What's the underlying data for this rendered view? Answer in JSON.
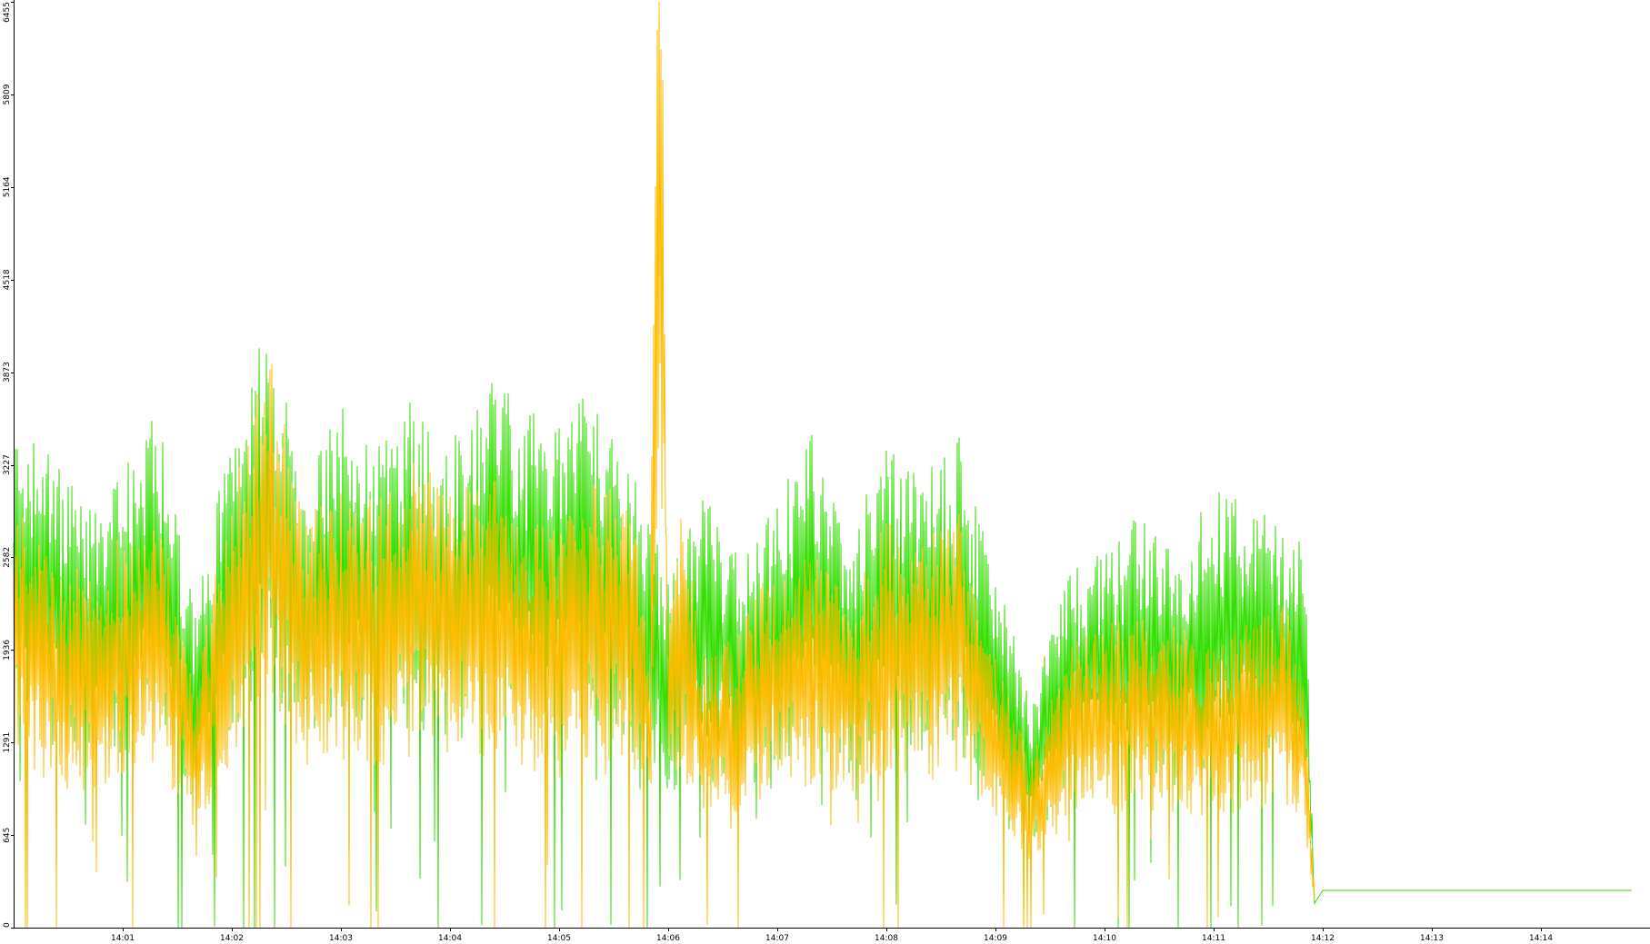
{
  "chart_data": {
    "type": "line",
    "title": "",
    "xlabel": "",
    "ylabel": "",
    "ylim": [
      0,
      6455
    ],
    "grid": false,
    "legend": "none",
    "y_ticks": [
      {
        "value": 0,
        "label": "0"
      },
      {
        "value": 645,
        "label": "645"
      },
      {
        "value": 1291,
        "label": "1291"
      },
      {
        "value": 1936,
        "label": "1936"
      },
      {
        "value": 2582,
        "label": "2582"
      },
      {
        "value": 3227,
        "label": "3227"
      },
      {
        "value": 3873,
        "label": "3873"
      },
      {
        "value": 4518,
        "label": "4518"
      },
      {
        "value": 5164,
        "label": "5164"
      },
      {
        "value": 5809,
        "label": "5809"
      },
      {
        "value": 6455,
        "label": "6455"
      }
    ],
    "xlim": [
      "14:00:00",
      "14:14:50"
    ],
    "x_ticks": [
      {
        "value": "14:01:00",
        "label": "14:01"
      },
      {
        "value": "14:02:00",
        "label": "14:02"
      },
      {
        "value": "14:03:00",
        "label": "14:03"
      },
      {
        "value": "14:04:00",
        "label": "14:04"
      },
      {
        "value": "14:05:00",
        "label": "14:05"
      },
      {
        "value": "14:06:00",
        "label": "14:06"
      },
      {
        "value": "14:07:00",
        "label": "14:07"
      },
      {
        "value": "14:08:00",
        "label": "14:08"
      },
      {
        "value": "14:09:00",
        "label": "14:09"
      },
      {
        "value": "14:10:00",
        "label": "14:10"
      },
      {
        "value": "14:11:00",
        "label": "14:11"
      },
      {
        "value": "14:12:00",
        "label": "14:12"
      },
      {
        "value": "14:13:00",
        "label": "14:13"
      },
      {
        "value": "14:14:00",
        "label": "14:14"
      }
    ],
    "series": [
      {
        "color": "#33dd00",
        "x": [
          "14:00:00",
          "14:00:20",
          "14:00:40",
          "14:01:00",
          "14:01:20",
          "14:01:40",
          "14:02:00",
          "14:02:20",
          "14:02:40",
          "14:03:00",
          "14:03:20",
          "14:03:40",
          "14:04:00",
          "14:04:20",
          "14:04:40",
          "14:05:00",
          "14:05:20",
          "14:05:40",
          "14:06:00",
          "14:06:20",
          "14:06:40",
          "14:07:00",
          "14:07:20",
          "14:07:40",
          "14:08:00",
          "14:08:20",
          "14:08:40",
          "14:09:00",
          "14:09:20",
          "14:09:40",
          "14:10:00",
          "14:10:20",
          "14:10:40",
          "14:11:00",
          "14:11:20",
          "14:11:40",
          "14:11:50",
          "14:11:55",
          "14:12:00",
          "14:13:00",
          "14:14:00",
          "14:14:50"
        ],
        "values": [
          2400,
          2300,
          2000,
          2200,
          2500,
          1500,
          2450,
          2900,
          2200,
          2500,
          2300,
          2550,
          2300,
          2700,
          2500,
          2450,
          2600,
          2200,
          1700,
          2100,
          1750,
          2050,
          2400,
          1900,
          2300,
          2200,
          2350,
          1700,
          1100,
          1750,
          1800,
          2000,
          1800,
          2100,
          2050,
          1900,
          1850,
          250,
          260,
          260,
          260,
          260
        ]
      },
      {
        "color": "#ffbb00",
        "x": [
          "14:00:00",
          "14:00:20",
          "14:00:40",
          "14:01:00",
          "14:01:20",
          "14:01:40",
          "14:02:00",
          "14:02:20",
          "14:02:40",
          "14:03:00",
          "14:03:20",
          "14:03:40",
          "14:04:00",
          "14:04:20",
          "14:04:40",
          "14:05:00",
          "14:05:20",
          "14:05:40",
          "14:05:50",
          "14:05:55",
          "14:06:00",
          "14:06:05",
          "14:06:20",
          "14:06:40",
          "14:07:00",
          "14:07:20",
          "14:07:40",
          "14:08:00",
          "14:08:20",
          "14:08:40",
          "14:09:00",
          "14:09:20",
          "14:09:40",
          "14:10:00",
          "14:10:20",
          "14:10:40",
          "14:11:00",
          "14:11:20",
          "14:11:40",
          "14:11:50",
          "14:11:55"
        ],
        "values": [
          2100,
          1800,
          1700,
          1900,
          2000,
          1200,
          2100,
          2800,
          2000,
          2100,
          2050,
          2250,
          2100,
          2200,
          2000,
          1900,
          2150,
          2050,
          1400,
          5900,
          1500,
          2100,
          1300,
          1450,
          1800,
          1800,
          1600,
          1950,
          1850,
          2000,
          1300,
          800,
          1350,
          1450,
          1500,
          1450,
          1350,
          1500,
          1550,
          1200,
          300
        ]
      }
    ]
  }
}
